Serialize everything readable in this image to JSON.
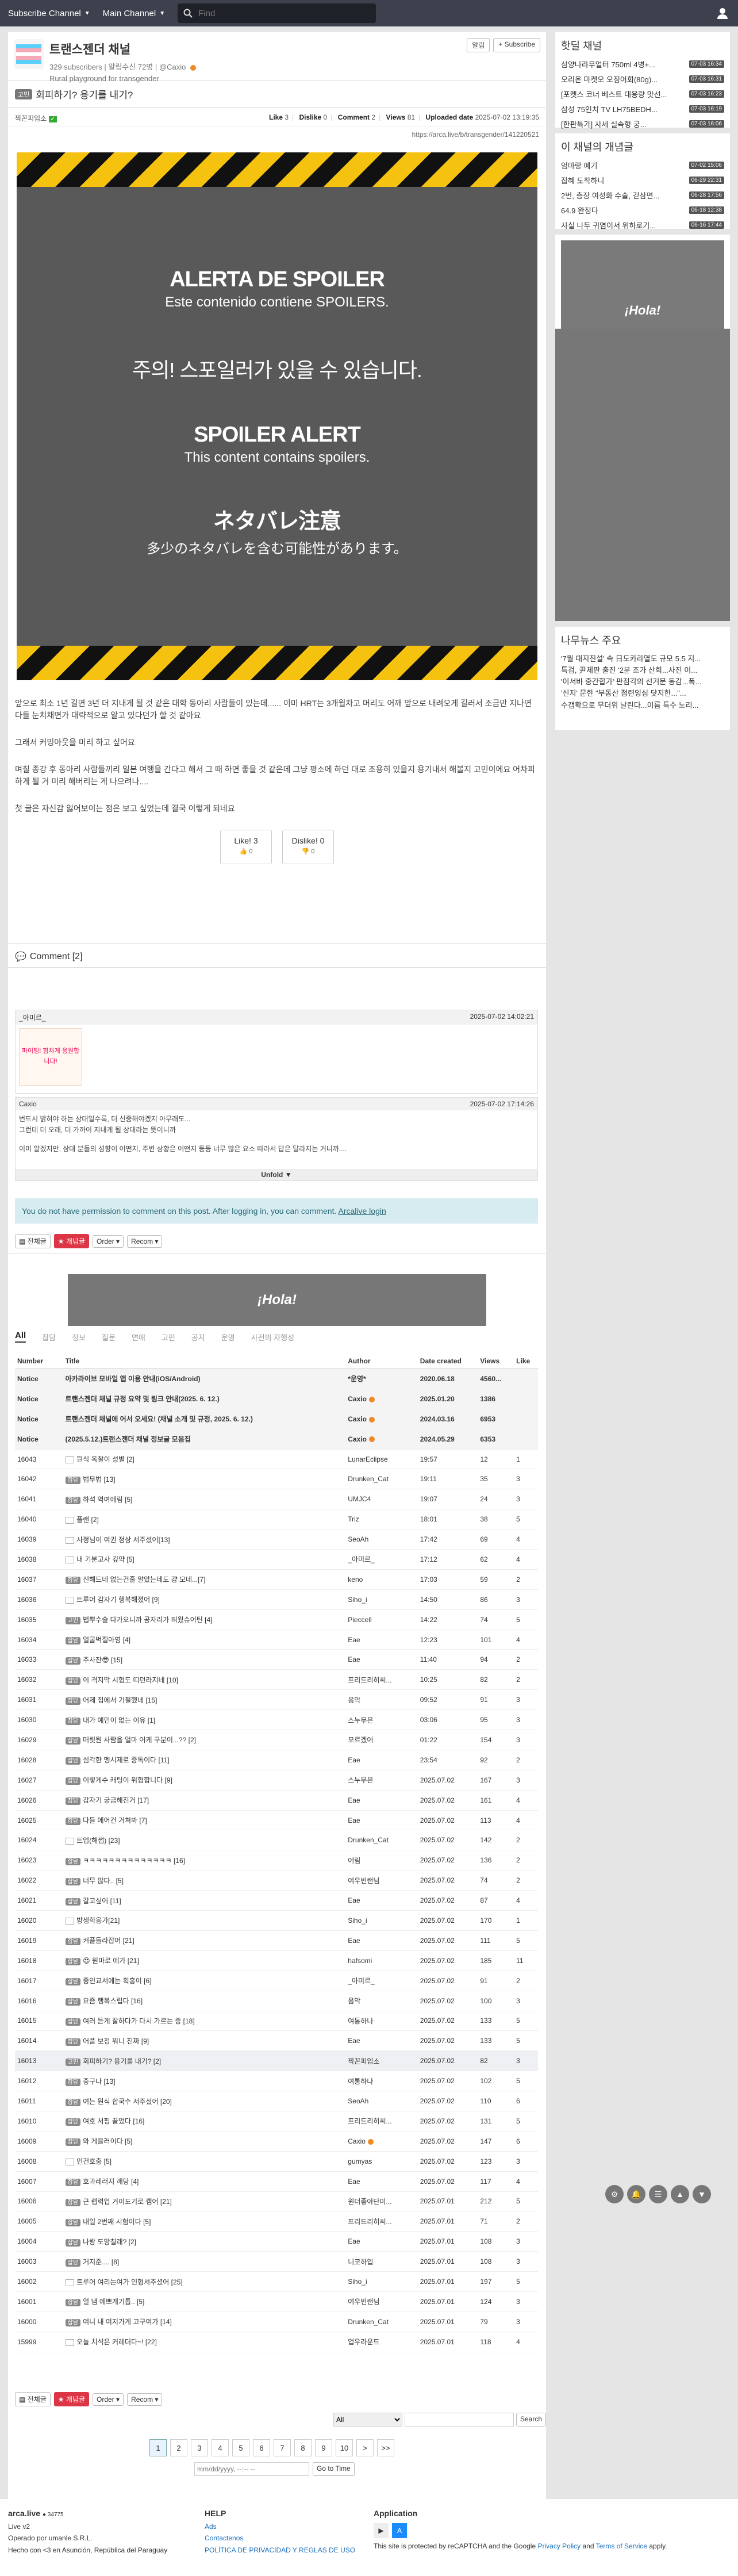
{
  "topbar": {
    "subscribe_label": "Subscribe Channel",
    "main_label": "Main Channel",
    "search_placeholder": "Find"
  },
  "channel": {
    "title": "트랜스젠더 채널",
    "subscribers": "329 subscribers",
    "alarm": "알림수신 72명",
    "owner": "@Caxio",
    "desc": "Rural playground for transgender",
    "alarm_btn": "알림",
    "subscribe_btn": "+ Subscribe"
  },
  "post": {
    "category": "고민",
    "title": "회피하기? 용기를 내기?",
    "author": "짝꼰피임소",
    "like": "3",
    "dislike": "0",
    "comment": "2",
    "views": "81",
    "uploaded": "2025-07-02 13:19:35",
    "link": "https://arca.live/b/transgender/141220521",
    "spoiler": [
      {
        "big": "ALERTA DE SPOILER",
        "small": "Este contenido contiene SPOILERS."
      },
      {
        "big": "주의! 스포일러가 있을 수 있습니다.",
        "small": ""
      },
      {
        "big": "SPOILER ALERT",
        "small": "This content contains spoilers."
      },
      {
        "big": "ネタバレ注意",
        "small": "多少のネタバレを含む可能性があります。"
      }
    ],
    "body": [
      "앞으로 최소 1년 길면 3년 더 지내게 될 것 같은 대학 동아리 사람들이 있는데...... 이미 HRT는 3개월차고 머리도 어깨 앞으로 내려오게 길러서 조금만 지나면 다들 눈치채면가 대략적으로 알고 있다던가 할 것 같아요",
      "그래서 커밍아웃을 미리 하고 싶어요",
      "며칠 종강 후 동아리 사람들끼리 일본 여행을 간다고 해서 그 때 하면 좋을 것 같은데 그냥 평소에 하던 대로 조용히 있을지 용기내서 해볼지 고민이에요 어차피 하게 될 거 미리 해버리는 게 나으려나....",
      "첫 글은 자신감 잃어보이는 점은 보고 싶었는데 결국 이렇게 되네요"
    ],
    "like_label": "Like!",
    "dislike_label": "Dislike!"
  },
  "comments": {
    "header": "Comment [2]",
    "items": [
      {
        "author": "_아미르_",
        "date": "2025-07-02 14:02:21",
        "body": "파이팅! 힘차게 응원합니다!"
      },
      {
        "author": "Caxio",
        "date": "2025-07-02 17:14:26",
        "body1": "번드시 밝혀야 하는 상대일수록, 더 신중해야겠지 아무래도...",
        "body2": "그런데 더 오래, 더 가까이 지내게 될 상대라는 뜻이니까",
        "body3": "이미 알겠지만, 상대 분들의 성향이 어떤지, 주변 상황은 어떤지 등등 너무 많은 요소 따라서 답은 달라지는 거니까...."
      }
    ],
    "unfold": "Unfold",
    "permission": "You do not have permission to comment on this post. After logging in, you can comment.",
    "login_link": "Arcalive login"
  },
  "toolbar": {
    "all": "전체글",
    "best": "개념글",
    "order": "Order",
    "recom": "Recom"
  },
  "ad_text": "¡Hola!",
  "tabs": [
    "All",
    "잡담",
    "정보",
    "질문",
    "연애",
    "고민",
    "공지",
    "운영",
    "사전의 자행성"
  ],
  "list": {
    "headers": [
      "Number",
      "Title",
      "Author",
      "Date created",
      "Views",
      "Like"
    ],
    "notices": [
      {
        "num": "Notice",
        "title": "아카라이브 모바일 앱 이용 안내(iOS/Android)",
        "author": "*운영*",
        "date": "2020.06.18",
        "views": "4560...",
        "like": ""
      },
      {
        "num": "Notice",
        "title": "트랜스젠더 채널 규정 요약 및 링크 안내(2025. 6. 12.)",
        "author": "Caxio",
        "date": "2025.01.20",
        "views": "1386",
        "like": ""
      },
      {
        "num": "Notice",
        "title": "트랜스젠더 채널에 어서 오세요! (채널 소개 및 규정, 2025. 6. 12.)",
        "author": "Caxio",
        "date": "2024.03.16",
        "views": "6953",
        "like": ""
      },
      {
        "num": "Notice",
        "title": "(2025.5.12.)트랜스젠더 채널 정보글 모음집",
        "author": "Caxio",
        "date": "2024.05.29",
        "views": "6353",
        "like": ""
      }
    ],
    "rows": [
      {
        "num": "16043",
        "cat": "",
        "title": "뭔식 옥잘이 성별 [2]",
        "author": "LunarEclipse",
        "date": "19:57",
        "views": "12",
        "like": "1"
      },
      {
        "num": "16042",
        "cat": "잡담",
        "title": "법무법 [13]",
        "author": "Drunken_Cat",
        "date": "19:11",
        "views": "35",
        "like": "3"
      },
      {
        "num": "16041",
        "cat": "잡담",
        "title": "하석 역여에림 [5]",
        "author": "UMJC4",
        "date": "19:07",
        "views": "24",
        "like": "3"
      },
      {
        "num": "16040",
        "cat": "",
        "title": "플랜 [2]",
        "author": "Triz",
        "date": "18:01",
        "views": "38",
        "like": "5"
      },
      {
        "num": "16039",
        "cat": "",
        "title": "사정님이 여권 정상 서주셨어[13]",
        "author": "SeoAh",
        "date": "17:42",
        "views": "69",
        "like": "4"
      },
      {
        "num": "16038",
        "cat": "",
        "title": "내 기분고사 깊약 [5]",
        "author": "_아미르_",
        "date": "17:12",
        "views": "62",
        "like": "4"
      },
      {
        "num": "16037",
        "cat": "잡담",
        "title": "신해드네 없는건줄 알았는데도 걍 모네...[7]",
        "author": "keno",
        "date": "17:03",
        "views": "59",
        "like": "2"
      },
      {
        "num": "16036",
        "cat": "",
        "title": "트루어 감자기 행복해졌어 [9]",
        "author": "Siho_i",
        "date": "14:50",
        "views": "86",
        "like": "3"
      },
      {
        "num": "16035",
        "cat": "고민",
        "title": "법뿌수술 다가오니까 공자리가 띄웠슈어틴 [4]",
        "author": "Pieccell",
        "date": "14:22",
        "views": "74",
        "like": "5"
      },
      {
        "num": "16034",
        "cat": "잡담",
        "title": "얼굴벅질아영 [4]",
        "author": "Eae",
        "date": "12:23",
        "views": "101",
        "like": "4"
      },
      {
        "num": "16033",
        "cat": "잡담",
        "title": "주사잔😎 [15]",
        "author": "Eae",
        "date": "11:40",
        "views": "94",
        "like": "2"
      },
      {
        "num": "16032",
        "cat": "잡담",
        "title": "이 격지막 시험도 띠던라지네 [10]",
        "author": "프리드리히씨...",
        "date": "10:25",
        "views": "82",
        "like": "2"
      },
      {
        "num": "16031",
        "cat": "잡담",
        "title": "어제 집에서 기절했네 [15]",
        "author": "음악",
        "date": "09:52",
        "views": "91",
        "like": "3"
      },
      {
        "num": "16030",
        "cat": "잡담",
        "title": "내가 예민이 없는 이유 [1]",
        "author": "스누무믄",
        "date": "03:06",
        "views": "95",
        "like": "3"
      },
      {
        "num": "16029",
        "cat": "잡담",
        "title": "머릿뭔 사람을 얼마 어케 구분이...?? [2]",
        "author": "모르겠어",
        "date": "01:22",
        "views": "154",
        "like": "3"
      },
      {
        "num": "16028",
        "cat": "잡담",
        "title": "섬각한 멩시제로 중독이다 [11]",
        "author": "Eae",
        "date": "23:54",
        "views": "92",
        "like": "2"
      },
      {
        "num": "16027",
        "cat": "잡담",
        "title": "이렇게수 캐팅이 위험합니다 [9]",
        "author": "스누무믄",
        "date": "2025.07.02",
        "views": "167",
        "like": "3"
      },
      {
        "num": "16026",
        "cat": "잡담",
        "title": "감자기 궁금해진거 [17]",
        "author": "Eae",
        "date": "2025.07.02",
        "views": "161",
        "like": "4"
      },
      {
        "num": "16025",
        "cat": "잡담",
        "title": "다들 에어컨 거쳐봐 [7]",
        "author": "Eae",
        "date": "2025.07.02",
        "views": "113",
        "like": "4"
      },
      {
        "num": "16024",
        "cat": "",
        "title": "트업(해썹) [23]",
        "author": "Drunken_Cat",
        "date": "2025.07.02",
        "views": "142",
        "like": "2"
      },
      {
        "num": "16023",
        "cat": "잡담",
        "title": "ㅋㅋㅋㅋㅋㅋㅋㅋㅋㅋㅋㅋㅋㅋ [16]",
        "author": "어림",
        "date": "2025.07.02",
        "views": "136",
        "like": "2"
      },
      {
        "num": "16022",
        "cat": "잡담",
        "title": "너무 많다.. [5]",
        "author": "여우빈랜님",
        "date": "2025.07.02",
        "views": "74",
        "like": "2"
      },
      {
        "num": "16021",
        "cat": "잡담",
        "title": "갈고싶어 [11]",
        "author": "Eae",
        "date": "2025.07.02",
        "views": "87",
        "like": "4"
      },
      {
        "num": "16020",
        "cat": "",
        "title": "방생학응가[21]",
        "author": "Siho_i",
        "date": "2025.07.02",
        "views": "170",
        "like": "1"
      },
      {
        "num": "16019",
        "cat": "잡담",
        "title": "커플들라잡어 [21]",
        "author": "Eae",
        "date": "2025.07.02",
        "views": "111",
        "like": "5"
      },
      {
        "num": "16018",
        "cat": "잡담",
        "title": "😍 원마로 에가 [21]",
        "author": "hafsomi",
        "date": "2025.07.02",
        "views": "185",
        "like": "11"
      },
      {
        "num": "16017",
        "cat": "잡담",
        "title": "종인교서에는 획흥이 [6]",
        "author": "_아미르_",
        "date": "2025.07.02",
        "views": "91",
        "like": "2"
      },
      {
        "num": "16016",
        "cat": "잡담",
        "title": "요즘 행복스럽다 [16]",
        "author": "음악",
        "date": "2025.07.02",
        "views": "100",
        "like": "3"
      },
      {
        "num": "16015",
        "cat": "잡담",
        "title": "여러 듣게 잘하다가 다시 가르는 중 [18]",
        "author": "여통하나",
        "date": "2025.07.02",
        "views": "133",
        "like": "5"
      },
      {
        "num": "16014",
        "cat": "잡담",
        "title": "어플 보정 뭐니 진짜 [9]",
        "author": "Eae",
        "date": "2025.07.02",
        "views": "133",
        "like": "5"
      },
      {
        "num": "16013",
        "cat": "고민",
        "title": "회피하기? 용기를 내기? [2]",
        "author": "짝꼰피임소",
        "date": "2025.07.02",
        "views": "82",
        "like": "3",
        "current": true
      },
      {
        "num": "16012",
        "cat": "잡담",
        "title": "중구나 [13]",
        "author": "여통하나",
        "date": "2025.07.02",
        "views": "102",
        "like": "5"
      },
      {
        "num": "16011",
        "cat": "잡담",
        "title": "여는 뭔식 합국수 서주셨어 [20]",
        "author": "SeoAh",
        "date": "2025.07.02",
        "views": "110",
        "like": "6"
      },
      {
        "num": "16010",
        "cat": "잡담",
        "title": "여호 서핑 끌었다 [16]",
        "author": "프리드리히씨...",
        "date": "2025.07.02",
        "views": "131",
        "like": "5"
      },
      {
        "num": "16009",
        "cat": "잡담",
        "title": "와 게을러이다 [5]",
        "author": "Caxio",
        "date": "2025.07.02",
        "views": "147",
        "like": "6"
      },
      {
        "num": "16008",
        "cat": "",
        "title": "인건호충 [5]",
        "author": "gumyas",
        "date": "2025.07.02",
        "views": "123",
        "like": "3"
      },
      {
        "num": "16007",
        "cat": "잡담",
        "title": "호과레러지 깨당 [4]",
        "author": "Eae",
        "date": "2025.07.02",
        "views": "117",
        "like": "4"
      },
      {
        "num": "16006",
        "cat": "잡담",
        "title": "근 렙력업 거이도기로 캠어 [21]",
        "author": "원더좋아단미...",
        "date": "2025.07.01",
        "views": "212",
        "like": "5"
      },
      {
        "num": "16005",
        "cat": "잡담",
        "title": "내일 2번째 시험이다 [5]",
        "author": "프리드리히씨...",
        "date": "2025.07.01",
        "views": "71",
        "like": "2"
      },
      {
        "num": "16004",
        "cat": "잡담",
        "title": "나랑 도망칠래? [2]",
        "author": "Eae",
        "date": "2025.07.01",
        "views": "108",
        "like": "3"
      },
      {
        "num": "16003",
        "cat": "잡담",
        "title": "거지준.... [8]",
        "author": "니코하입",
        "date": "2025.07.01",
        "views": "108",
        "like": "3"
      },
      {
        "num": "16002",
        "cat": "",
        "title": "트루어 여리는여가 인형셔주셨어 [25]",
        "author": "Siho_i",
        "date": "2025.07.01",
        "views": "197",
        "like": "5"
      },
      {
        "num": "16001",
        "cat": "잡담",
        "title": "얼 냄 예쁘게기톱.. [5]",
        "author": "여우빈랜님",
        "date": "2025.07.01",
        "views": "124",
        "like": "3"
      },
      {
        "num": "16000",
        "cat": "잡담",
        "title": "여니 내 여지가게 고구여가 [14]",
        "author": "Drunken_Cat",
        "date": "2025.07.01",
        "views": "79",
        "like": "3"
      },
      {
        "num": "15999",
        "cat": "",
        "title": "오늘 치석은 커레더다~! [22]",
        "author": "업우라운드",
        "date": "2025.07.01",
        "views": "118",
        "like": "4"
      }
    ]
  },
  "search": {
    "scope": "All",
    "btn": "Search"
  },
  "pager": [
    "1",
    "2",
    "3",
    "4",
    "5",
    "6",
    "7",
    "8",
    "9",
    "10",
    ">",
    ">>"
  ],
  "date_jump": {
    "placeholder": "mm/dd/yyyy, --:-- --",
    "btn": "Go to Time"
  },
  "sidebar": {
    "hot_title": "핫딜 채널",
    "hot": [
      {
        "t": "삼양나라무얼터 750ml 4병+...",
        "time": "07-03 16:34"
      },
      {
        "t": "오리온 마켓오 오징어회(80g)...",
        "time": "07-03 16:31"
      },
      {
        "t": "[포켓스 코너 베스트 대용량 맛선...",
        "time": "07-03 16:23"
      },
      {
        "t": "삼성 75인치 TV LH75BEDH...",
        "time": "07-03 16:19"
      },
      {
        "t": "[한판특가] 사세 실속형 궁...",
        "time": "07-03 16:06"
      }
    ],
    "best_title": "이 채널의 개념글",
    "best": [
      {
        "t": "엄마랑 예기",
        "time": "07-02 15:06"
      },
      {
        "t": "잡혜 도착하니",
        "time": "06-29 22:31"
      },
      {
        "t": "2번, 층장 여성화 수술, 걷삼면...",
        "time": "06-28 17:56"
      },
      {
        "t": "64.9 완정다",
        "time": "06-18 12:38"
      },
      {
        "t": "사실 나두 귀염이서 위하로기...",
        "time": "06-16 17:44"
      }
    ],
    "news_title": "나무뉴스 주요",
    "news": [
      "'7월 대지진설' 속 日도카라열도 규모 5.5 지...",
      "특검, 尹체판 출진 '2분 조가 산회...사진 이...",
      "'이서바 중간합가' 판점각의 선거문 동감...폭...",
      "'신지' 문한 \"부동산 점련잉심 닷지한...\"...",
      "수갭확으로 무더위 날린다...이름 특수 노리..."
    ]
  },
  "footer": {
    "site": "arca.live",
    "users": "34775",
    "live": "Live v2",
    "operator": "Operado por umanle S.R.L.",
    "made": "Hecho con <3 en Asunción, República del Paraguay",
    "help_title": "HELP",
    "help": [
      "Ads",
      "Contactenos",
      "POLÍTICA DE PRIVACIDAD Y REGLAS DE USO"
    ],
    "app_title": "Application",
    "recaptcha": "This site is protected by reCAPTCHA and the Google",
    "privacy": "Privacy Policy",
    "and": "and",
    "terms": "Terms of Service",
    "apply": "apply."
  }
}
